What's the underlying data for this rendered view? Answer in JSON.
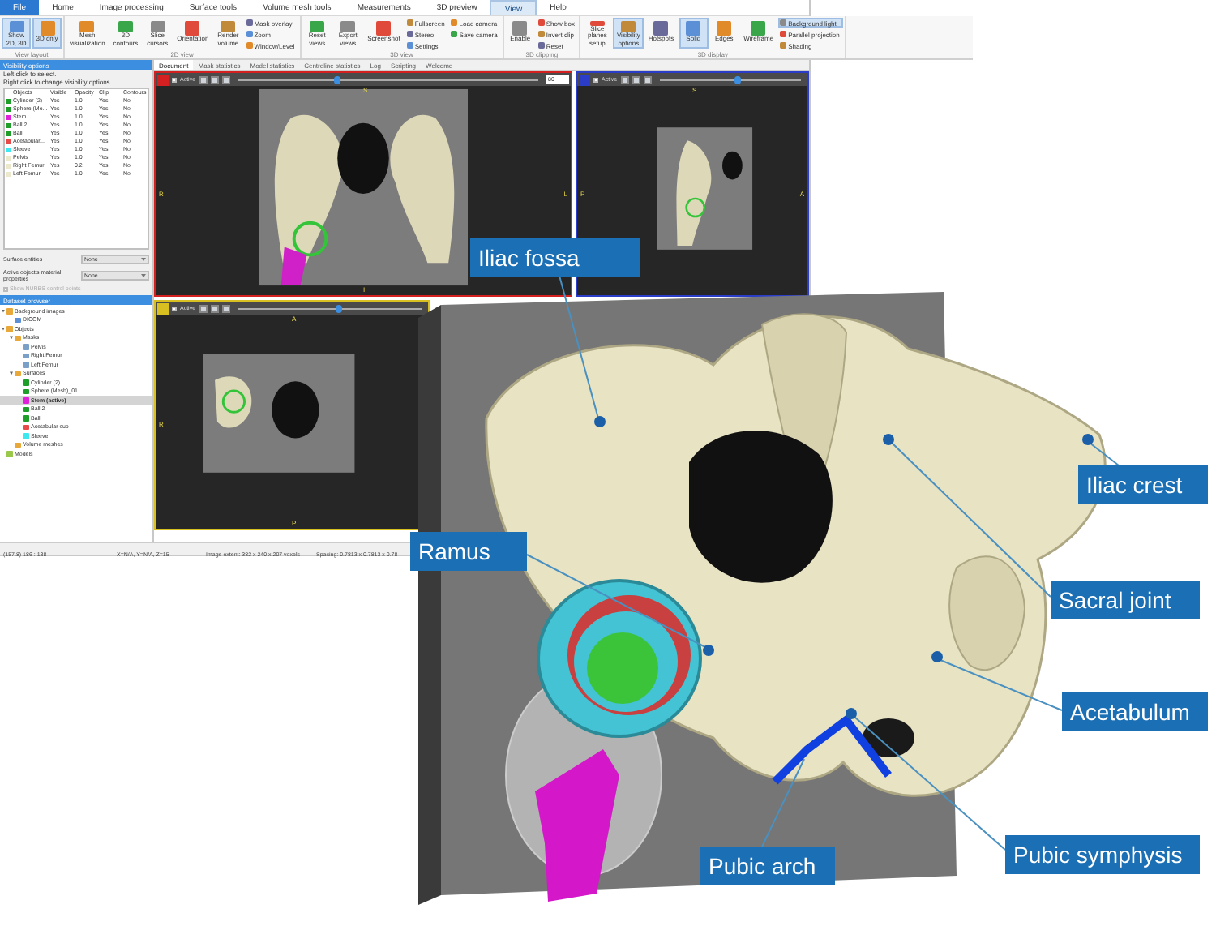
{
  "ribbon_tabs": [
    {
      "label": "File",
      "selected": false,
      "kind": "file"
    },
    {
      "label": "Home",
      "selected": false,
      "kind": "tab"
    },
    {
      "label": "Image processing",
      "selected": false,
      "kind": "tab"
    },
    {
      "label": "Surface tools",
      "selected": false,
      "kind": "tab"
    },
    {
      "label": "Volume mesh tools",
      "selected": false,
      "kind": "tab"
    },
    {
      "label": "Measurements",
      "selected": false,
      "kind": "tab"
    },
    {
      "label": "3D preview",
      "selected": false,
      "kind": "tab"
    },
    {
      "label": "View",
      "selected": true,
      "kind": "tab"
    },
    {
      "label": "Help",
      "selected": false,
      "kind": "tab"
    }
  ],
  "ribbon_groups": [
    {
      "label": "View layout",
      "buttons": [
        {
          "label": "Show 2D, 3D",
          "kind": "large",
          "selected": true
        },
        {
          "label": "3D only",
          "kind": "large",
          "selected": true
        }
      ]
    },
    {
      "label": "2D view",
      "buttons": [
        {
          "label": "Mesh visualization",
          "kind": "large",
          "selected": false
        },
        {
          "label": "3D contours",
          "kind": "large",
          "selected": false
        },
        {
          "label": "Slice cursors",
          "kind": "large",
          "selected": false
        },
        {
          "label": "Orientation",
          "kind": "large",
          "selected": false
        },
        {
          "label": "Render volume",
          "kind": "large",
          "selected": false
        },
        {
          "label": "Mask overlay",
          "kind": "small",
          "selected": false
        },
        {
          "label": "Zoom",
          "kind": "small",
          "selected": false
        },
        {
          "label": "Window/Level",
          "kind": "small",
          "selected": false
        }
      ]
    },
    {
      "label": "3D view",
      "buttons": [
        {
          "label": "Reset views",
          "kind": "large",
          "selected": false
        },
        {
          "label": "Export views",
          "kind": "large",
          "selected": false
        },
        {
          "label": "Screenshot",
          "kind": "large",
          "selected": false
        },
        {
          "label": "Fullscreen",
          "kind": "small",
          "selected": false
        },
        {
          "label": "Stereo",
          "kind": "small",
          "selected": false
        },
        {
          "label": "Settings",
          "kind": "small",
          "selected": false
        },
        {
          "label": "Load camera",
          "kind": "small",
          "selected": false
        },
        {
          "label": "Save camera",
          "kind": "small",
          "selected": false
        }
      ]
    },
    {
      "label": "3D clipping",
      "buttons": [
        {
          "label": "Enable",
          "kind": "large",
          "selected": false
        },
        {
          "label": "Show box",
          "kind": "small",
          "selected": false
        },
        {
          "label": "Invert clip",
          "kind": "small",
          "selected": false
        },
        {
          "label": "Reset",
          "kind": "small",
          "selected": false
        }
      ]
    },
    {
      "label": "3D display",
      "buttons": [
        {
          "label": "Slice planes setup",
          "kind": "large",
          "selected": false
        },
        {
          "label": "Visibility options",
          "kind": "large",
          "selected": true
        },
        {
          "label": "Hotspots",
          "kind": "large",
          "selected": false
        },
        {
          "label": "Solid",
          "kind": "large",
          "selected": true
        },
        {
          "label": "Edges",
          "kind": "large",
          "selected": false
        },
        {
          "label": "Wireframe",
          "kind": "large",
          "selected": false
        },
        {
          "label": "Background light",
          "kind": "small",
          "selected": true
        },
        {
          "label": "Parallel projection",
          "kind": "small",
          "selected": false
        },
        {
          "label": "Shading",
          "kind": "small",
          "selected": false
        }
      ]
    }
  ],
  "visibility_panel": {
    "title": "Visibility options",
    "hints": [
      "Left click to select.",
      "Right click to change visibility options."
    ],
    "columns": [
      "Objects",
      "Visible",
      "Opacity",
      "Clip",
      "Contours"
    ],
    "rows": [
      {
        "color": "#1f9e2a",
        "cells": [
          "Cylinder (2)",
          "Yes",
          "1.0",
          "Yes",
          "No"
        ]
      },
      {
        "color": "#1f9e2a",
        "cells": [
          "Sphere (Me...",
          "Yes",
          "1.0",
          "Yes",
          "No"
        ]
      },
      {
        "color": "#e020d8",
        "cells": [
          "Stem",
          "Yes",
          "1.0",
          "Yes",
          "No"
        ]
      },
      {
        "color": "#1f9e2a",
        "cells": [
          "Ball 2",
          "Yes",
          "1.0",
          "Yes",
          "No"
        ]
      },
      {
        "color": "#1f9e2a",
        "cells": [
          "Ball",
          "Yes",
          "1.0",
          "Yes",
          "No"
        ]
      },
      {
        "color": "#e84a4a",
        "cells": [
          "Acetabular...",
          "Yes",
          "1.0",
          "Yes",
          "No"
        ]
      },
      {
        "color": "#3ee8f0",
        "cells": [
          "Sleeve",
          "Yes",
          "1.0",
          "Yes",
          "No"
        ]
      },
      {
        "color": "#ece8cc",
        "cells": [
          "Pelvis",
          "Yes",
          "1.0",
          "Yes",
          "No"
        ]
      },
      {
        "color": "#ece8cc",
        "cells": [
          "Right Femur",
          "Yes",
          "0.2",
          "Yes",
          "No"
        ]
      },
      {
        "color": "#ece8cc",
        "cells": [
          "Left Femur",
          "Yes",
          "1.0",
          "Yes",
          "No"
        ]
      }
    ],
    "fields": [
      {
        "label": "Surface entities",
        "value": "None"
      },
      {
        "label": "Active object's material properties",
        "value": "None"
      }
    ],
    "nurbs_checkbox": {
      "label": "Show NURBS control points",
      "checked": false,
      "disabled": true
    }
  },
  "dataset_browser": {
    "title": "Dataset browser",
    "tree": [
      {
        "label": "Background images",
        "kind": "folder",
        "selected": false,
        "children": [
          {
            "label": "DICOM",
            "kind": "image",
            "selected": false
          }
        ]
      },
      {
        "label": "Objects",
        "kind": "folder",
        "selected": false,
        "children": [
          {
            "label": "Masks",
            "kind": "folder",
            "selected": false,
            "children": [
              {
                "label": "Pelvis",
                "kind": "mask",
                "selected": false
              },
              {
                "label": "Right Femur",
                "kind": "mask",
                "selected": false
              },
              {
                "label": "Left Femur",
                "kind": "mask",
                "selected": false
              }
            ]
          },
          {
            "label": "Surfaces",
            "kind": "folder",
            "selected": false,
            "children": [
              {
                "label": "Cylinder (2)",
                "kind": "surface",
                "color": "#1f9e2a",
                "selected": false
              },
              {
                "label": "Sphere (Mesh)_01",
                "kind": "surface",
                "color": "#1f9e2a",
                "selected": false
              },
              {
                "label": "Stem (active)",
                "kind": "surface",
                "color": "#e020d8",
                "selected": true
              },
              {
                "label": "Ball 2",
                "kind": "surface",
                "color": "#1f9e2a",
                "selected": false
              },
              {
                "label": "Ball",
                "kind": "surface",
                "color": "#1f9e2a",
                "selected": false
              },
              {
                "label": "Acetabular cup",
                "kind": "surface",
                "color": "#e84a4a",
                "selected": false
              },
              {
                "label": "Sleeve",
                "kind": "surface",
                "color": "#3ee8f0",
                "selected": false
              }
            ]
          },
          {
            "label": "Volume meshes",
            "kind": "folder",
            "selected": false
          }
        ]
      },
      {
        "label": "Models",
        "kind": "model",
        "selected": false
      }
    ]
  },
  "document_tabs": [
    {
      "label": "Document",
      "selected": true
    },
    {
      "label": "Mask statistics",
      "selected": false
    },
    {
      "label": "Model statistics",
      "selected": false
    },
    {
      "label": "Centreline statistics",
      "selected": false
    },
    {
      "label": "Log",
      "selected": false
    },
    {
      "label": "Scripting",
      "selected": false
    },
    {
      "label": "Welcome",
      "selected": false
    }
  ],
  "views": [
    {
      "color": "#d42020",
      "active_label": "Active",
      "active": false,
      "slider": {
        "level": 0.33
      },
      "value": "80",
      "letters": {
        "top": "S",
        "left": "R",
        "right": "L",
        "bottom": "I"
      }
    },
    {
      "color": "#2a3cc8",
      "active_label": "Active",
      "active": false,
      "slider": {
        "level": 0.55
      },
      "letters": {
        "top": "S",
        "left": "P",
        "right": "A"
      }
    },
    {
      "color": "#d8c020",
      "active_label": "Active",
      "active": false,
      "slider": {
        "level": 0.55
      },
      "letters": {
        "top": "A",
        "left": "R",
        "bottom": "P"
      }
    }
  ],
  "status_bar": [
    "(157.8) 186 : 138",
    "X=N/A, Y=N/A, Z=15",
    "Image extent: 382 x 240 x 207 voxels",
    "Spacing: 0.7813 x 0.7813 x 0.78"
  ],
  "annotations": [
    "Iliac fossa",
    "Iliac crest",
    "Sacral joint",
    "Ramus",
    "Acetabulum",
    "Pubic arch",
    "Pubic symphysis"
  ]
}
